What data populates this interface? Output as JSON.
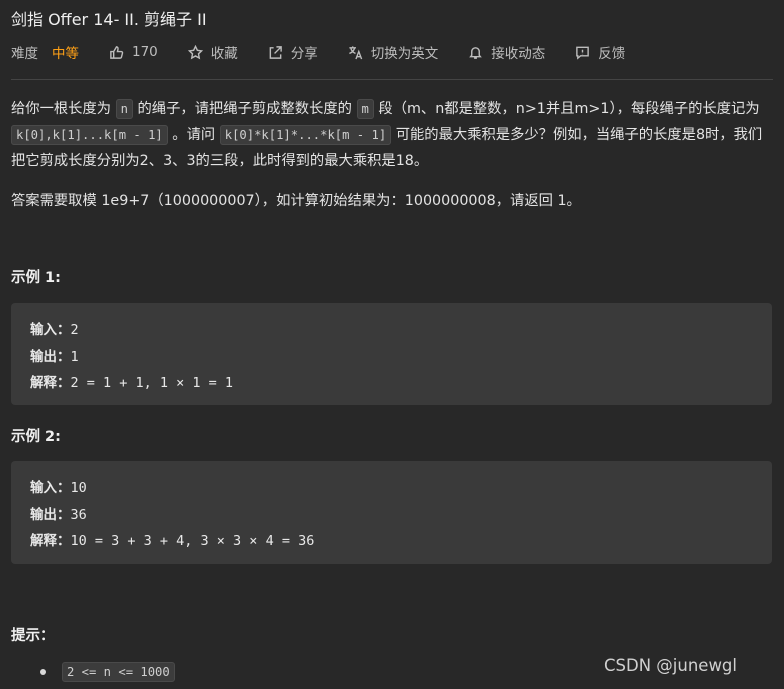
{
  "problem": {
    "title": "剑指 Offer 14- II. 剪绳子 II",
    "difficulty_label": "难度",
    "difficulty": "中等",
    "likes": "170",
    "favorite": "收藏",
    "share": "分享",
    "switch_lang": "切换为英文",
    "subscribe": "接收动态",
    "feedback": "反馈",
    "colors": {
      "difficulty": "#ffa116",
      "background": "#282828",
      "code_bg": "#3a3a3a"
    }
  },
  "description": {
    "p1_a": "给你一根长度为",
    "code_n": "n",
    "p1_b": "的绳子，请把绳子剪成整数长度的",
    "code_m": "m",
    "p1_c": "段（m、n都是整数，n>1并且m>1），每段绳子的长度记为",
    "code_k": "k[0],k[1]...k[m - 1]",
    "p1_d": "。请问",
    "code_prod": "k[0]*k[1]*...*k[m - 1]",
    "p1_e": "可能的最大乘积是多少？例如，当绳子的长度是8时，我们把它剪成长度分别为2、3、3的三段，此时得到的最大乘积是18。",
    "p2": "答案需要取模 1e9+7（1000000007），如计算初始结果为：1000000008，请返回 1。"
  },
  "examples": [
    {
      "heading": "示例 1:",
      "input_label": "输入：",
      "input": "2",
      "output_label": "输出：",
      "output": "1",
      "explain_label": "解释：",
      "explain": "2 = 1 + 1, 1 × 1 = 1"
    },
    {
      "heading": "示例 2:",
      "input_label": "输入：",
      "input": "10",
      "output_label": "输出：",
      "output": "36",
      "explain_label": "解释：",
      "explain": "10 = 3 + 3 + 4, 3 × 3 × 4 = 36"
    }
  ],
  "hint": {
    "heading": "提示：",
    "items": [
      "2 <= n <= 1000"
    ]
  },
  "watermark": "CSDN @junewgl",
  "icons": {
    "like": "thumbs-up-icon",
    "favorite": "star-icon",
    "share": "share-icon",
    "translate": "translate-icon",
    "subscribe": "bell-icon",
    "feedback": "feedback-icon"
  }
}
